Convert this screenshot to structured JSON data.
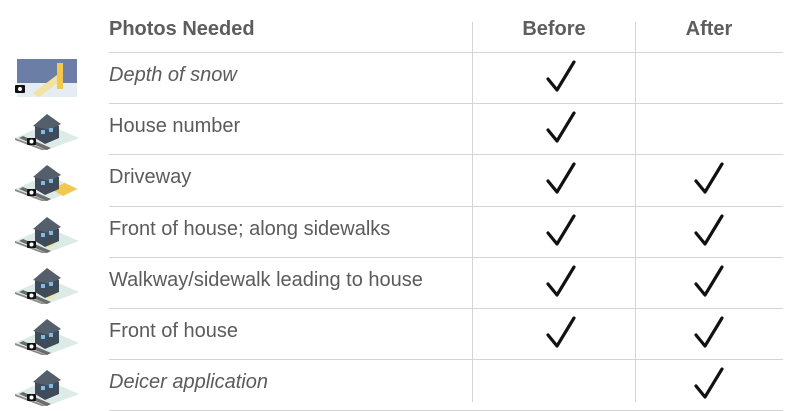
{
  "table": {
    "headers": {
      "photos": "Photos Needed",
      "before": "Before",
      "after": "After"
    },
    "rows": [
      {
        "label": "Depth of snow",
        "italic": true,
        "before": true,
        "after": false,
        "icon": "snow-depth-camera-icon"
      },
      {
        "label": "House number",
        "italic": false,
        "before": true,
        "after": false,
        "icon": "house-camera-icon"
      },
      {
        "label": "Driveway",
        "italic": false,
        "before": true,
        "after": true,
        "icon": "house-driveway-camera-icon"
      },
      {
        "label": "Front of house; along sidewalks",
        "italic": false,
        "before": true,
        "after": true,
        "icon": "house-sidewalk-camera-icon"
      },
      {
        "label": "Walkway/sidewalk leading to house",
        "italic": false,
        "before": true,
        "after": true,
        "icon": "house-walkway-camera-icon"
      },
      {
        "label": "Front of house",
        "italic": false,
        "before": true,
        "after": true,
        "icon": "house-front-camera-icon"
      },
      {
        "label": "Deicer application",
        "italic": true,
        "before": false,
        "after": true,
        "icon": "house-deicer-camera-icon"
      }
    ]
  },
  "colors": {
    "text": "#5b5b5b",
    "rule": "#d4d4d4",
    "check": "#111111",
    "highlight": "#f2c94c"
  }
}
